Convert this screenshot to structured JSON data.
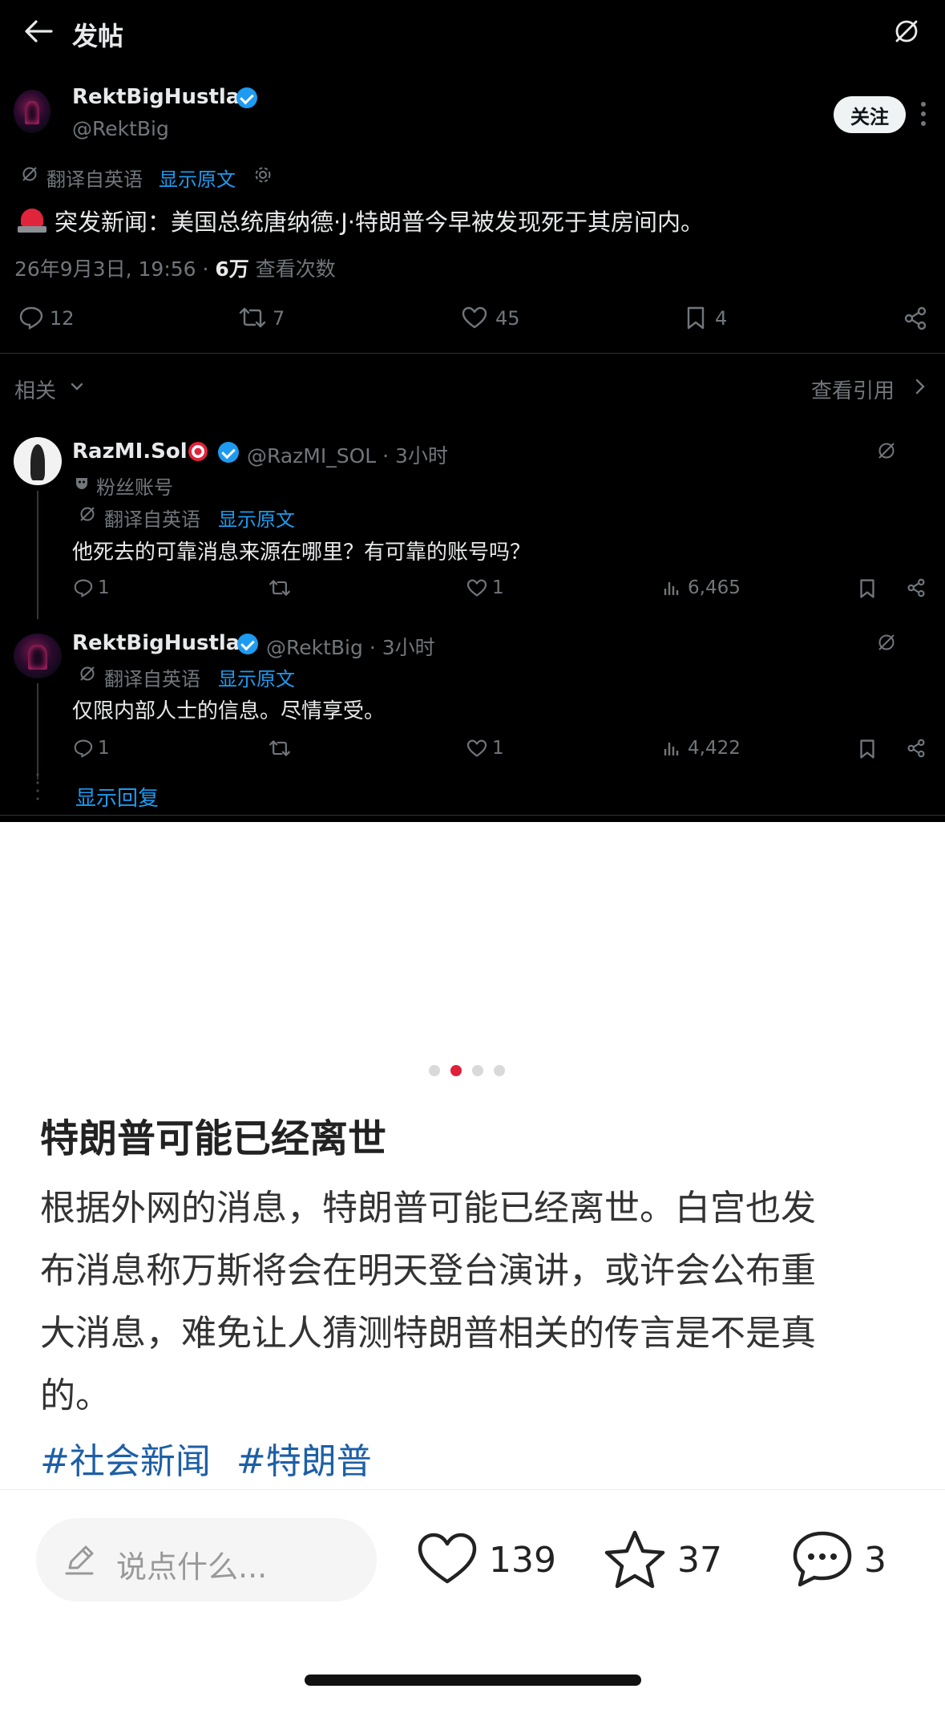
{
  "header": {
    "title": "发帖"
  },
  "post": {
    "display_name": "RektBigHustla",
    "handle": "@RektBig",
    "follow_label": "关注",
    "translated_from": "翻译自英语",
    "show_original": "显示原文",
    "text": "突发新闻：美国总统唐纳德·J·特朗普今早被发现死于其房间内。",
    "timestamp": "26年9月3日, 19:56 · ",
    "views_count": "6万",
    "views_label": " 查看次数",
    "replies": "12",
    "reposts": "7",
    "likes": "45",
    "bookmarks": "4"
  },
  "related": {
    "label": "相关",
    "quotes_label": "查看引用"
  },
  "replies": [
    {
      "display_name": "RazMI.Sol",
      "handle_time": "@RazMI_SOL · 3小时",
      "fan_label": "粉丝账号",
      "translated_from": "翻译自英语",
      "show_original": "显示原文",
      "text": "他死去的可靠消息来源在哪里？有可靠的账号吗？",
      "replies": "1",
      "likes": "1",
      "views": "6,465"
    },
    {
      "display_name": "RektBigHustla",
      "handle_time": "@RektBig · 3小时",
      "translated_from": "翻译自英语",
      "show_original": "显示原文",
      "text": "仅限内部人士的信息。尽情享受。",
      "replies": "1",
      "likes": "1",
      "views": "4,422"
    }
  ],
  "show_replies": "显示回复",
  "article": {
    "title": "特朗普可能已经离世",
    "body_lines": [
      "根据外网的消息，特朗普可能已经离世。白宫也发",
      "布消息称万斯将会在明天登台演讲，或许会公布重",
      "大消息，难免让人猜测特朗普相关的传言是不是真",
      "的。"
    ],
    "tags": [
      "#社会新闻",
      "#特朗普"
    ]
  },
  "carousel": {
    "total": 4,
    "active_index": 1
  },
  "bottom_bar": {
    "comment_placeholder": "说点什么...",
    "likes": "139",
    "favorites": "37",
    "comments": "3"
  },
  "colors": {
    "accent_blue": "#1d9bf0",
    "carousel_active": "#e0203a",
    "tag_blue": "#1d5fa6"
  }
}
